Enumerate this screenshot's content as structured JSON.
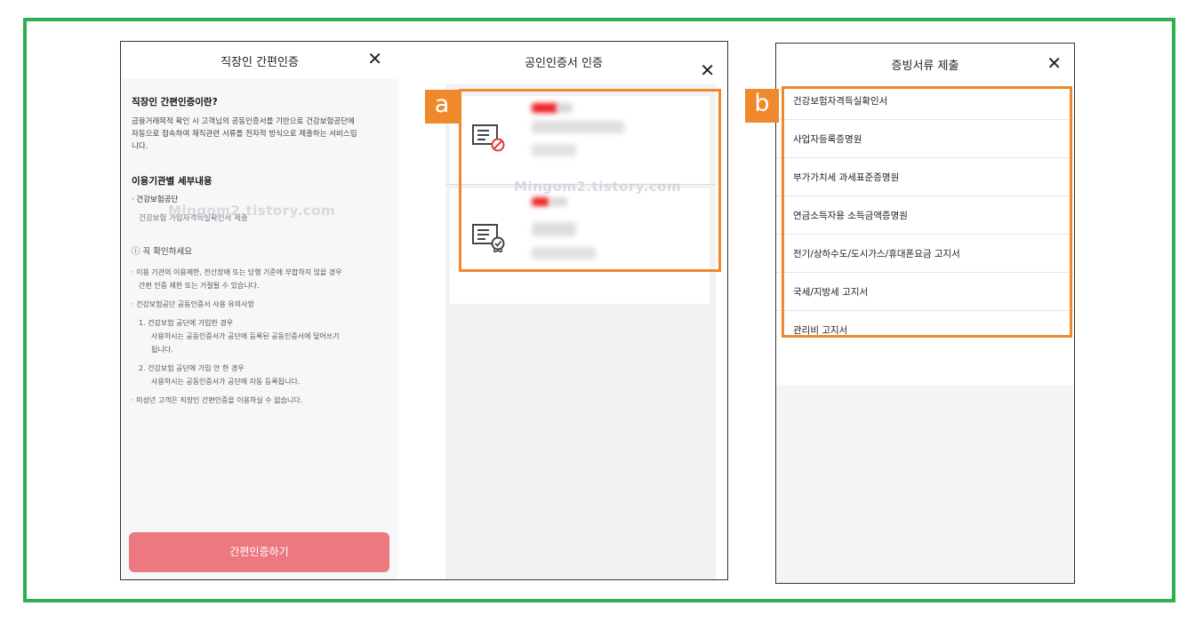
{
  "left_modal": {
    "title": "직장인 간편인증",
    "close": "✕",
    "what_heading": "직장인 간편인증이란?",
    "what_desc": [
      "금융거래목적 확인 시 고객님의 공동인증서를 기반으로 건강보험공단에",
      "자동으로 접속하여 재직관련 서류를 전자적 방식으로 제출하는 서비스입",
      "니다."
    ],
    "detail_heading": "이용기관별 세부내용",
    "org_name": "· 건강보험공단",
    "org_sub": "건강보험 가입자격득실확인서 제출",
    "notice_title": "ⓘ 꼭 확인하세요",
    "notice_bullets": [
      "· 이용 기관의 이용제한, 전산장애 또는 당행 기준에 부합하지 않을 경우",
      "간편 인증 제한 또는 거절될 수 있습니다.",
      "· 건강보험공단 공동인증서 사용 유의사항",
      "1.  건강보험 공단에 가입한 경우",
      "사용하시는 공동인증서가 공단에 등록된 공동인증서에 덮어쓰기",
      "됩니다.",
      "2.  건강보험 공단에 가입 안 한 경우",
      "사용하시는 공동인증서가 공단에 자동 등록됩니다.",
      "· 미성년 고객은 직장인 간편인증을 이용하실 수 없습니다."
    ],
    "submit_label": "간편인증하기"
  },
  "cert_modal": {
    "title": "공인인증서 인증",
    "close": "✕",
    "items": [
      {
        "icon": "certificate-revoked-icon"
      },
      {
        "icon": "certificate-valid-icon"
      }
    ]
  },
  "doc_modal": {
    "title": "증빙서류 제출",
    "close": "✕",
    "items": [
      "건강보험자격득실확인서",
      "사업자등록증명원",
      "부가가치세 과세표준증명원",
      "연금소득자용 소득금액증명원",
      "전기/상하수도/도시가스/휴대폰요금 고지서",
      "국세/지방세 고지서",
      "관리비 고지서"
    ]
  },
  "annotations": {
    "a": "a",
    "b": "b"
  },
  "watermark": "Mingom2.tistory.com",
  "colors": {
    "frame": "#2fb04e",
    "highlight": "#f0892c",
    "primary_button": "#ec7980"
  }
}
